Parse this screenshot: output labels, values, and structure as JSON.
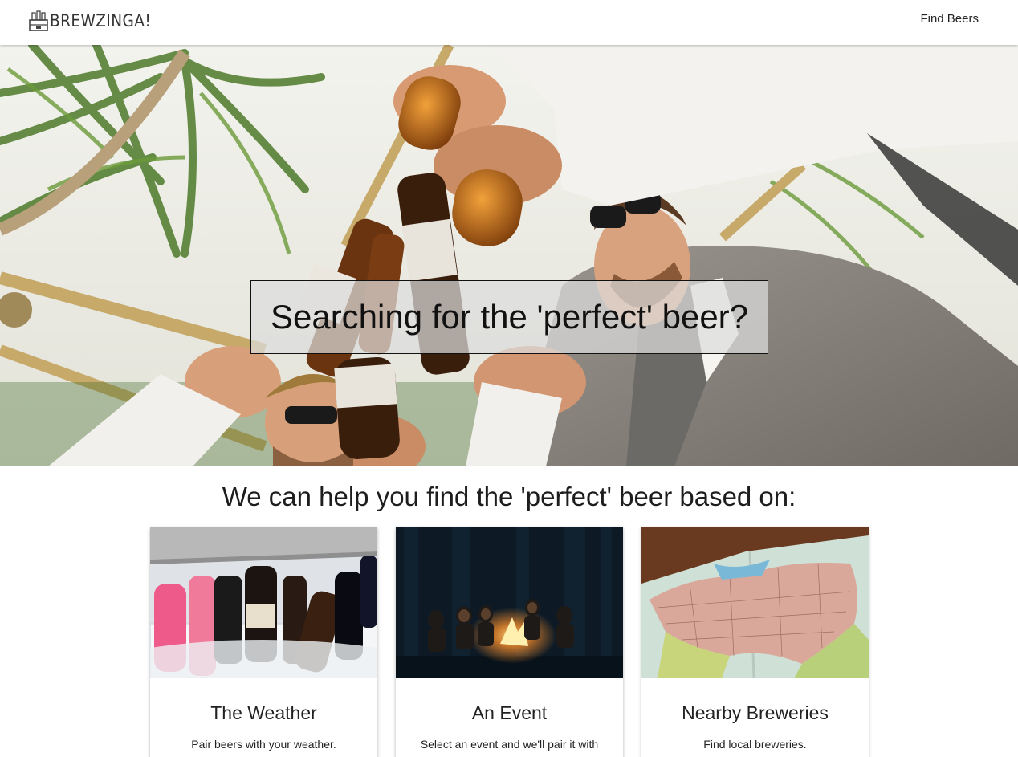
{
  "navbar": {
    "brand": "BREWZINGA!",
    "brand_icon": "beer-crate-icon",
    "link": "Find Beers"
  },
  "hero": {
    "image": "friends-toasting-beer-bottles-photo",
    "headline": "Searching for the 'perfect' beer?"
  },
  "section": {
    "title": "We can help you find the 'perfect' beer based on:"
  },
  "cards": [
    {
      "title": "The Weather",
      "text": "Pair beers with your weather.",
      "image": "bottles-on-ice-photo"
    },
    {
      "title": "An Event",
      "text": "Select an event and we'll pair it with",
      "image": "campfire-night-photo"
    },
    {
      "title": "Nearby Breweries",
      "text": "Find local breweries.",
      "image": "usa-map-photo"
    }
  ],
  "colors": {
    "navbar_bg": "#ffffff",
    "banner_bg": "#dcdcdc",
    "text": "#222222"
  }
}
